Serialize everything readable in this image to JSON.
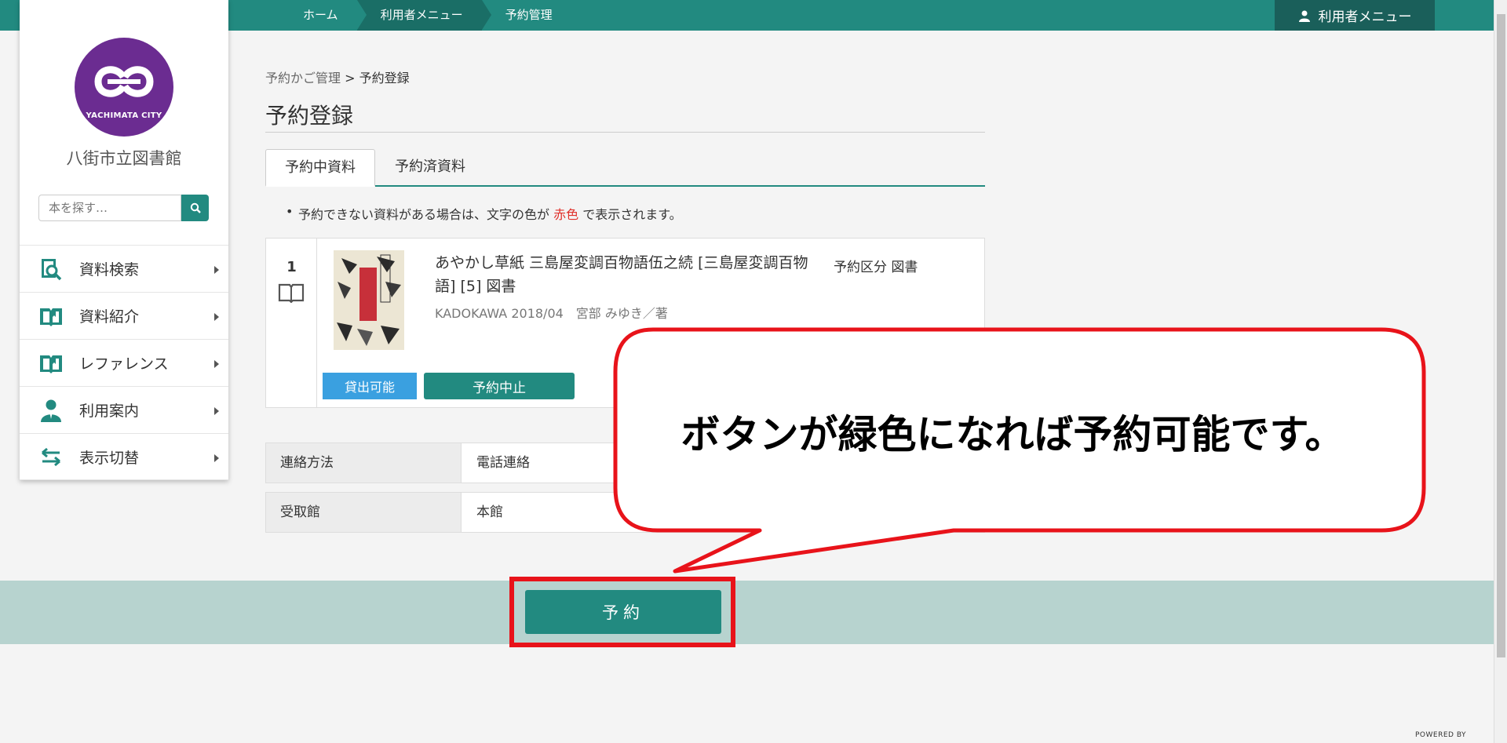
{
  "topbar": {
    "breadcrumbs": [
      "ホーム",
      "利用者メニュー",
      "予約管理"
    ],
    "user_menu": "利用者メニュー"
  },
  "sidebar": {
    "logo_text": "YACHIMATA CITY",
    "library_name": "八街市立図書館",
    "search_placeholder": "本を探す…",
    "items": [
      {
        "label": "資料検索",
        "icon": "search-book-icon"
      },
      {
        "label": "資料紹介",
        "icon": "open-book-icon"
      },
      {
        "label": "レファレンス",
        "icon": "open-book-icon"
      },
      {
        "label": "利用案内",
        "icon": "person-icon"
      },
      {
        "label": "表示切替",
        "icon": "swap-arrows-icon"
      }
    ]
  },
  "main": {
    "breadcrumb_link": "予約かご管理",
    "breadcrumb_sep": ">",
    "breadcrumb_current": "予約登録",
    "title": "予約登録",
    "tabs": [
      "予約中資料",
      "予約済資料"
    ],
    "note_before": "予約できない資料がある場合は、文字の色が",
    "note_red": "赤色",
    "note_after": "で表示されます。",
    "item": {
      "number": "1",
      "title": "あやかし草紙 三島屋変調百物語伍之続 [三島屋変調百物語] [5] 図書",
      "meta": "KADOKAWA 2018/04　宮部 みゆき／著",
      "kind": "予約区分 図書",
      "status": "貸出可能",
      "cancel_label": "予約中止"
    },
    "form": [
      {
        "label": "連絡方法",
        "value": "電話連絡"
      },
      {
        "label": "受取館",
        "value": "本館"
      }
    ],
    "reserve_label": "予約"
  },
  "callout": {
    "text": "ボタンが緑色になれば予約可能です。"
  },
  "footer": {
    "powered_by": "POWERED BY"
  },
  "colors": {
    "brand": "#228a80",
    "logo": "#6b2c91",
    "highlight": "#e8131a",
    "available": "#3aa0e0"
  }
}
